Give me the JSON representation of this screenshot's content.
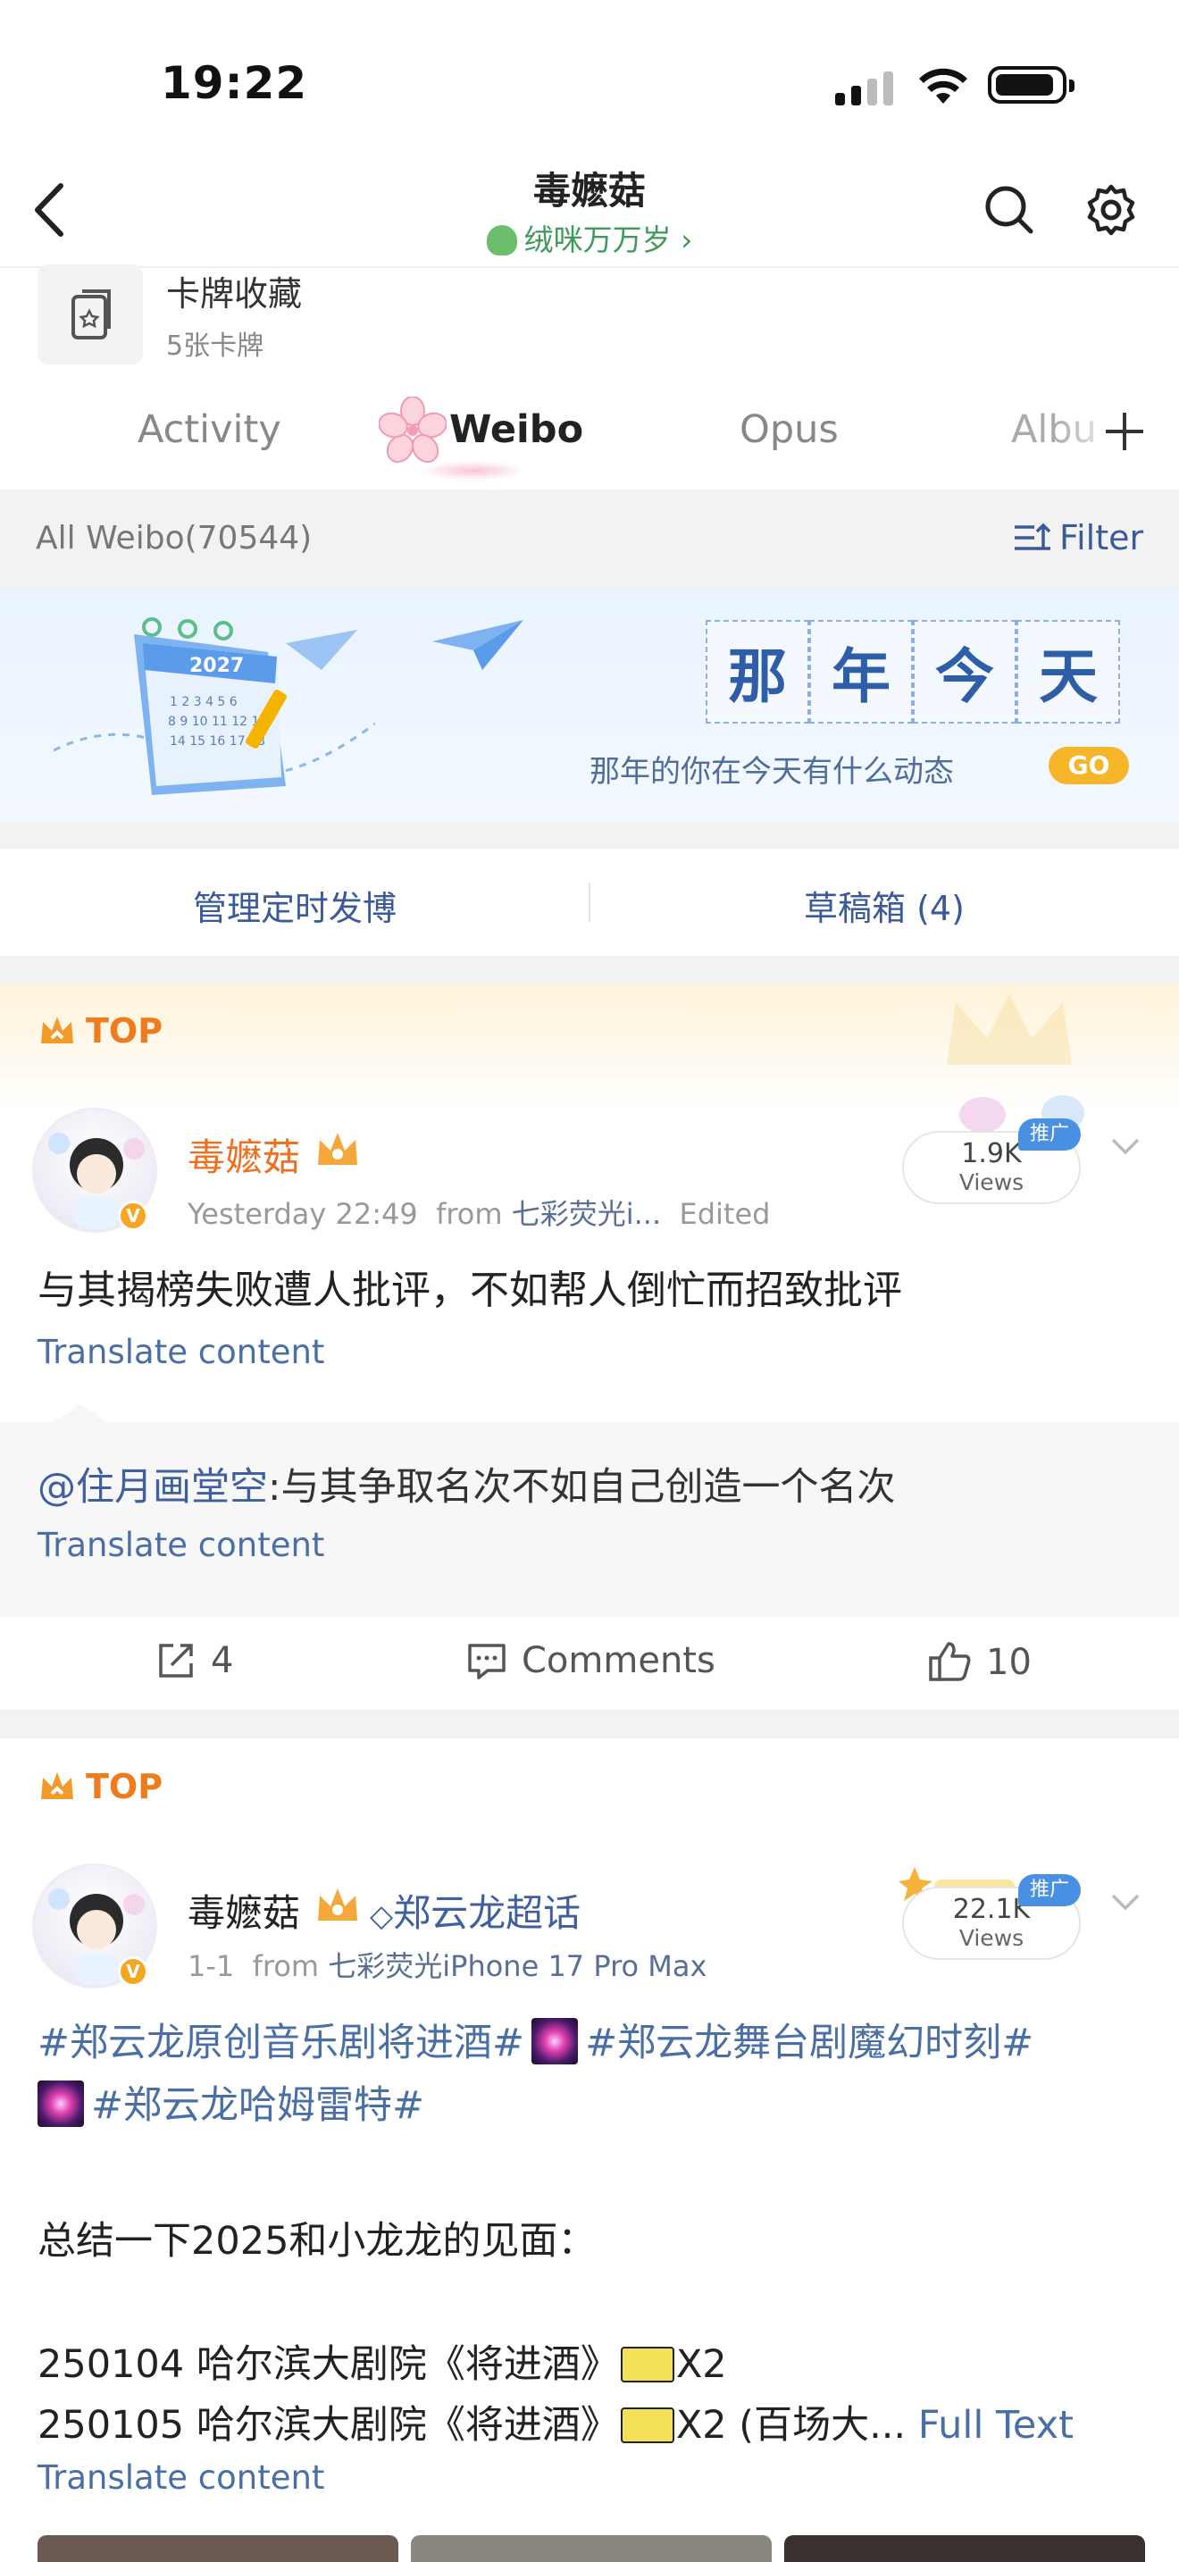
{
  "status_bar": {
    "time": "19:22"
  },
  "nav": {
    "title": "毒嬷菇",
    "subtitle": "绒咪万万岁 ›"
  },
  "card_item": {
    "title": "卡牌收藏",
    "subtitle": "5张卡牌"
  },
  "tabs": [
    {
      "label": "Activity",
      "active": false
    },
    {
      "label": "Weibo",
      "active": true
    },
    {
      "label": "Opus",
      "active": false
    },
    {
      "label": "Albu",
      "active": false
    }
  ],
  "filter_bar": {
    "all_label": "All Weibo(70544)",
    "filter_label": "Filter"
  },
  "banner": {
    "characters": [
      "那",
      "年",
      "今",
      "天"
    ],
    "caption": "那年的你在今天有什么动态",
    "go": "GO",
    "calendar_year": "2027"
  },
  "manage": {
    "scheduled": "管理定时发博",
    "drafts": "草稿箱 (4)"
  },
  "posts": [
    {
      "top_label": "TOP",
      "username": "毒嬷菇",
      "time": "Yesterday 22:49",
      "from_label": "from",
      "source": "七彩荧光i...",
      "edited": "Edited",
      "views": "1.9K",
      "views_label": "Views",
      "promo": "推广",
      "text": "与其揭榜失败遭人批评，不如帮人倒忙而招致批评",
      "translate": "Translate content",
      "repost": {
        "mention": "@住月画堂空",
        "text": ":与其争取名次不如自己创造一个名次",
        "translate": "Translate content"
      },
      "actions": {
        "reposts": "4",
        "comments": "Comments",
        "likes": "10"
      }
    },
    {
      "top_label": "TOP",
      "username": "毒嬷菇",
      "supertopic": "郑云龙超话",
      "time": "1-1",
      "from_label": "from",
      "source": "七彩荧光iPhone 17 Pro Max",
      "views": "22.1K",
      "views_label": "Views",
      "promo": "推广",
      "hashtags": [
        "#郑云龙原创音乐剧将进酒#",
        "#郑云龙舞台剧魔幻时刻#",
        "#郑云龙哈姆雷特#"
      ],
      "summary": "总结一下2025和小龙龙的见面：",
      "line1": "250104 哈尔滨大剧院《将进酒》",
      "line1_suffix": "X2",
      "line2": "250105 哈尔滨大剧院《将进酒》",
      "line2_suffix": "X2 (百场大...",
      "full_text": "Full Text",
      "translate": "Translate content"
    }
  ],
  "colors": {
    "link": "#4a6fa5",
    "orange": "#ee7b1c",
    "username_orange": "#f07020"
  }
}
